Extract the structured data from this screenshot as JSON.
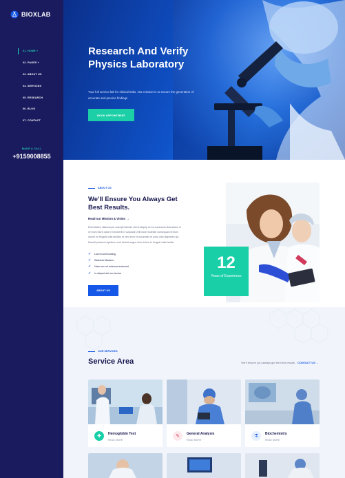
{
  "brand": {
    "name": "BIOXLAB"
  },
  "nav": {
    "items": [
      {
        "label": "01. HOME +"
      },
      {
        "label": "02. PAGES +"
      },
      {
        "label": "03. ABOUT US"
      },
      {
        "label": "04. SERVICES"
      },
      {
        "label": "05. RESEARCH"
      },
      {
        "label": "06. BLOG"
      },
      {
        "label": "07. CONTACT"
      }
    ],
    "active_index": 0
  },
  "contact": {
    "label": "MAKE A CALL",
    "phone": "+9159008855"
  },
  "hero": {
    "title": "Research And Verify Physics Laboratory",
    "text": "Your full service lab for clinical trials. Our mission is to ensure the generation of accurate and precise findings",
    "button": "BOOK APPOINTMENT"
  },
  "about": {
    "label": "ABOUT US",
    "title": "We'll Ensure You Always Get Best Results.",
    "link": "Read our Mission & Vision →",
    "text": "Exercitation ullamcorper suscipit lobortis nisl ut aliquip ex ea commodo duis autem in vel eum iriure dolor in hendrerit in vulputate velit esse molestie consequat vel illum dolore eu feugiat nulla facilisis at vero eros et accumsan et iusto odio dignissim qui blandit praesent luptatum zzril delenit augue duis dolore te feugait nulla facilisi.",
    "checks": [
      "Lorem sed funding",
      "Bacteria Markers",
      "Nam nec mi euismod euismod",
      "In aliquet dui nec lectus"
    ],
    "button": "ABOUT US",
    "years": {
      "number": "12",
      "label": "Years of Experience"
    }
  },
  "services": {
    "label": "OUR SERVICES",
    "title": "Service Area",
    "note": "We'll ensure you always get the best results.",
    "link": "CONTACT US →",
    "cards": [
      {
        "name": "Hemoglobin Test",
        "more": "READ MORE",
        "icon": "blood-drop-icon",
        "color": "#18cfa8"
      },
      {
        "name": "General Analysis",
        "more": "READ MORE",
        "icon": "syringe-icon",
        "color": "#fde8ec"
      },
      {
        "name": "Biochemistry",
        "more": "READ MORE",
        "icon": "flask-icon",
        "color": "#e6f0ff"
      }
    ]
  },
  "colors": {
    "sidebar": "#1a1a5e",
    "accent": "#18cfa8",
    "primary": "#1557e6"
  }
}
